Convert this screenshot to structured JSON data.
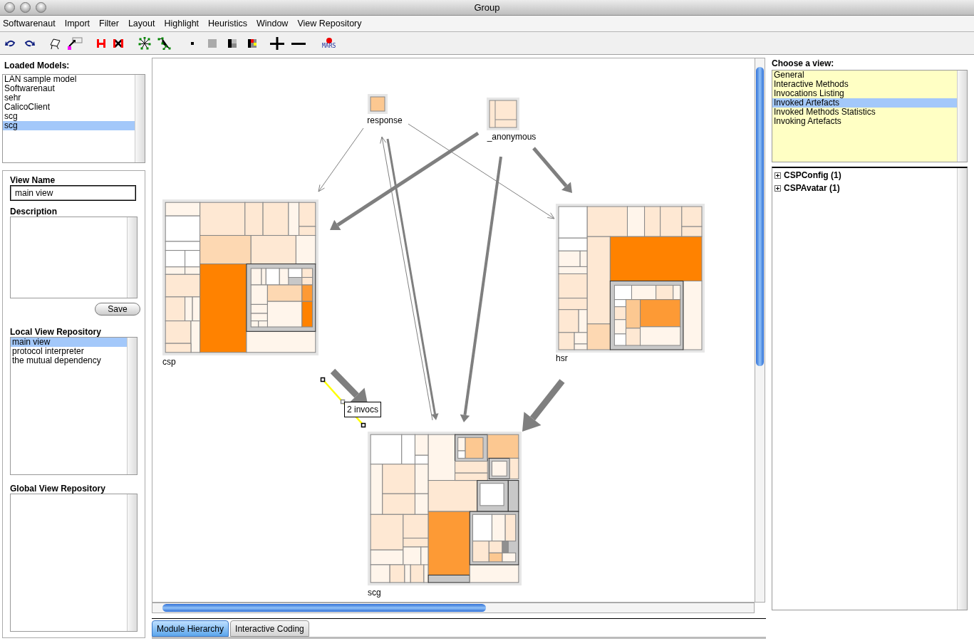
{
  "window": {
    "title": "Group"
  },
  "menu": [
    "Softwarenaut",
    "Import",
    "Filter",
    "Layout",
    "Highlight",
    "Heuristics",
    "Window",
    "View Repository"
  ],
  "toolbar": {
    "mars_label": "MARS"
  },
  "loaded_models": {
    "title": "Loaded Models:",
    "items": [
      {
        "label": "LAN sample model",
        "selected": false
      },
      {
        "label": "Softwarenaut",
        "selected": false
      },
      {
        "label": "sehr",
        "selected": false
      },
      {
        "label": "CalicoClient",
        "selected": false
      },
      {
        "label": "scg",
        "selected": false
      },
      {
        "label": "scg",
        "selected": true
      }
    ]
  },
  "view_form": {
    "name_label": "View Name",
    "name_value": "main view",
    "description_label": "Description",
    "save_button": "Save"
  },
  "local_view_repository": {
    "title": "Local View Repository",
    "items": [
      {
        "label": "main view",
        "selected": true
      },
      {
        "label": "protocol interpreter",
        "selected": false
      },
      {
        "label": "the mutual dependency",
        "selected": false
      }
    ]
  },
  "global_view_repository": {
    "title": "Global View Repository"
  },
  "canvas": {
    "nodes": [
      {
        "label": "response",
        "kind": "small"
      },
      {
        "label": "_anonymous",
        "kind": "split"
      },
      {
        "label": "csp",
        "kind": "csp"
      },
      {
        "label": "hsr",
        "kind": "hsr"
      },
      {
        "label": "scg",
        "kind": "scg"
      }
    ],
    "tooltip": "2 invocs"
  },
  "tabs": [
    {
      "label": "Module Hierarchy",
      "selected": true
    },
    {
      "label": "Interactive Coding",
      "selected": false
    }
  ],
  "views": {
    "title": "Choose a view:",
    "items": [
      {
        "label": "General",
        "selected": false
      },
      {
        "label": "Interactive Methods",
        "selected": false
      },
      {
        "label": "Invocations Listing",
        "selected": false
      },
      {
        "label": "Invoked Artefacts",
        "selected": true
      },
      {
        "label": "Invoked Methods Statistics",
        "selected": false
      },
      {
        "label": "Invoking Artefacts",
        "selected": false
      }
    ]
  },
  "tree": [
    {
      "label": "CSPConfig (1)",
      "expanded": false
    },
    {
      "label": "CSPAvatar (1)",
      "expanded": false
    }
  ]
}
